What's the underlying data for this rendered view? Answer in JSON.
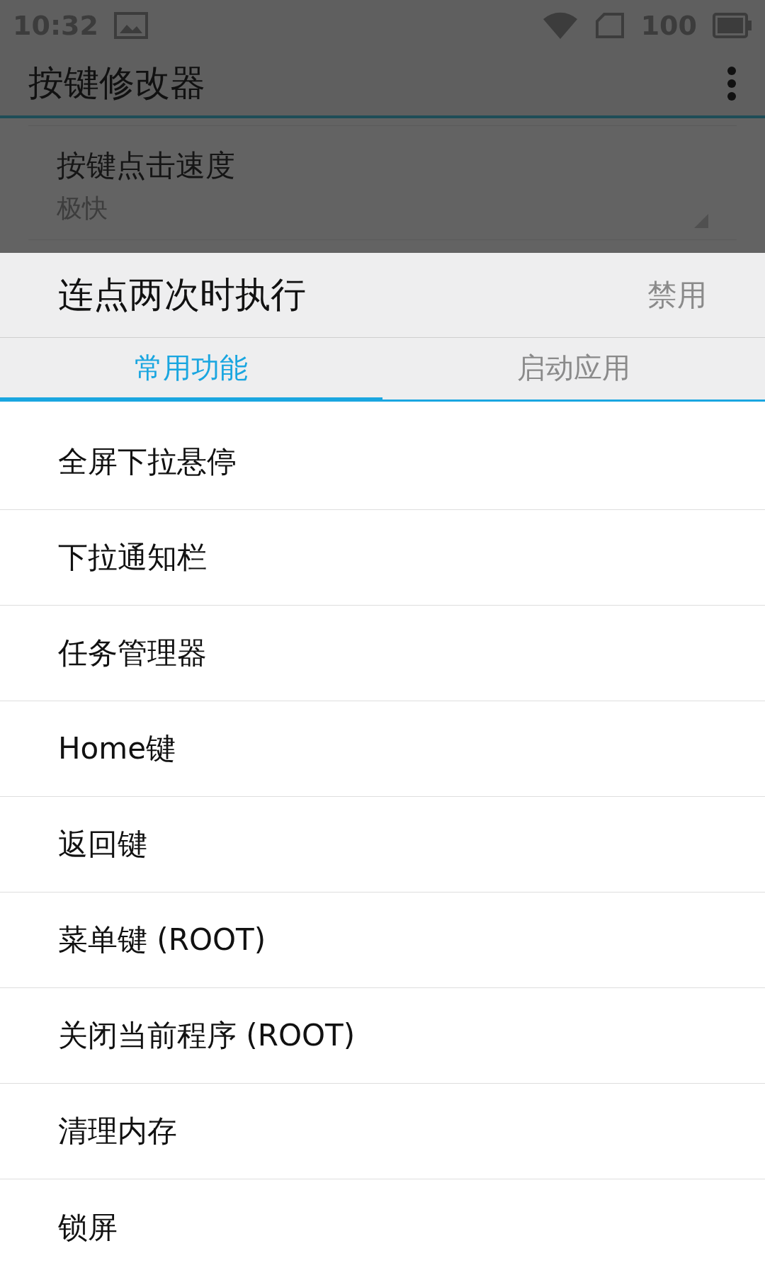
{
  "status_bar": {
    "time": "10:32",
    "battery_percent": "100"
  },
  "app_bar": {
    "title": "按键修改器"
  },
  "preference": {
    "title": "按键点击速度",
    "summary": "极快"
  },
  "dialog": {
    "title": "连点两次时执行",
    "action": "禁用",
    "tabs": [
      {
        "label": "常用功能",
        "selected": true
      },
      {
        "label": "启动应用",
        "selected": false
      }
    ],
    "items": [
      "全屏下拉悬停",
      "下拉通知栏",
      "任务管理器",
      "Home键",
      "返回键",
      "菜单键 (ROOT)",
      "关闭当前程序 (ROOT)",
      "清理内存",
      "锁屏"
    ]
  }
}
